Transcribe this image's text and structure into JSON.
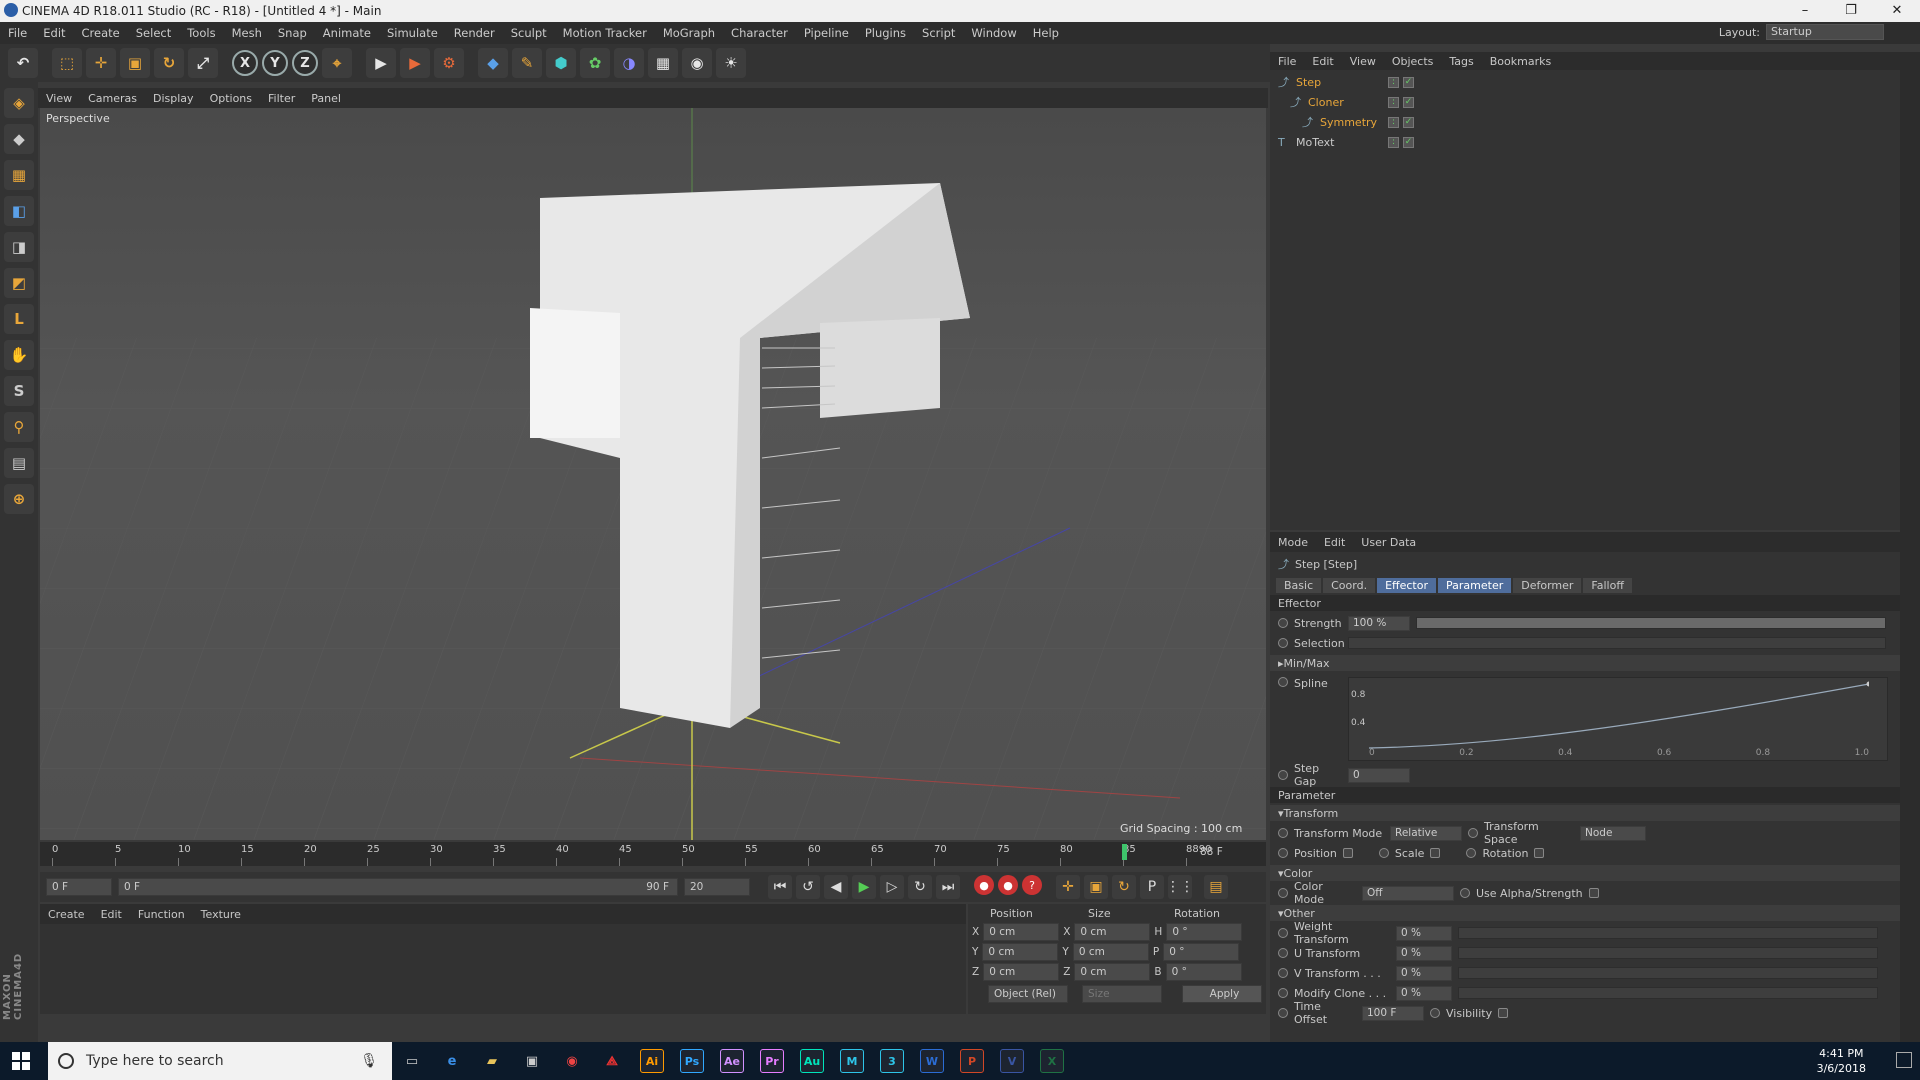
{
  "window": {
    "title": "CINEMA 4D R18.011 Studio (RC - R18) - [Untitled 4 *] - Main",
    "minimize": "–",
    "maximize": "❐",
    "close": "✕"
  },
  "menubar": [
    "File",
    "Edit",
    "Create",
    "Select",
    "Tools",
    "Mesh",
    "Snap",
    "Animate",
    "Simulate",
    "Render",
    "Sculpt",
    "Motion Tracker",
    "MoGraph",
    "Character",
    "Pipeline",
    "Plugins",
    "Script",
    "Window",
    "Help"
  ],
  "layout": {
    "label": "Layout:",
    "value": "Startup"
  },
  "toolbar": {
    "undo": "↶",
    "select": "⬚",
    "move": "✛",
    "scale": "▣",
    "rotate": "↻",
    "last": "⤢",
    "axis_x": "X",
    "axis_y": "Y",
    "axis_z": "Z",
    "coord_system": "⌖",
    "render_view": "▶",
    "render_pic": "▶",
    "render_settings": "⚙",
    "cube": "◆",
    "pen": "✎",
    "subdiv": "⬢",
    "cloner": "✿",
    "deformer": "◑",
    "floor": "▦",
    "camera": "◉",
    "light": "☀"
  },
  "left_tools": [
    "◈",
    "◆",
    "▦",
    "◧",
    "◨",
    "◩",
    "L",
    "✋",
    "S",
    "⚲",
    "▤",
    "⊕"
  ],
  "viewport": {
    "menu": [
      "View",
      "Cameras",
      "Display",
      "Options",
      "Filter",
      "Panel"
    ],
    "label": "Perspective",
    "grid_spacing": "Grid Spacing : 100 cm"
  },
  "timeline": {
    "ticks": [
      "0",
      "5",
      "10",
      "15",
      "20",
      "25",
      "30",
      "35",
      "40",
      "45",
      "50",
      "55",
      "60",
      "65",
      "70",
      "75",
      "80",
      "85",
      "8890"
    ],
    "current_frame": "88 F"
  },
  "transport": {
    "start": "0 F",
    "range_start": "0 F",
    "range_end": "90 F",
    "end": "20"
  },
  "material_manager": {
    "menu": [
      "Create",
      "Edit",
      "Function",
      "Texture"
    ]
  },
  "coordinates": {
    "headers": [
      "Position",
      "Size",
      "Rotation"
    ],
    "rows": [
      {
        "axis": "X",
        "pos": "0 cm",
        "saxis": "X",
        "size": "0 cm",
        "raxis": "H",
        "rot": "0 °"
      },
      {
        "axis": "Y",
        "pos": "0 cm",
        "saxis": "Y",
        "size": "0 cm",
        "raxis": "P",
        "rot": "0 °"
      },
      {
        "axis": "Z",
        "pos": "0 cm",
        "saxis": "Z",
        "size": "0 cm",
        "raxis": "B",
        "rot": "0 °"
      }
    ],
    "mode": "Object (Rel)",
    "size_mode": "Size",
    "apply": "Apply"
  },
  "object_manager": {
    "menu": [
      "File",
      "Edit",
      "View",
      "Objects",
      "Tags",
      "Bookmarks"
    ],
    "objects": [
      {
        "name": "Step",
        "indent": 0,
        "color": "#e8a63a"
      },
      {
        "name": "Cloner",
        "indent": 1,
        "color": "#e8a63a"
      },
      {
        "name": "Symmetry",
        "indent": 2,
        "color": "#e8a63a"
      },
      {
        "name": "MoText",
        "indent": 0,
        "color": "#cccccc"
      }
    ]
  },
  "attributes": {
    "menu": [
      "Mode",
      "Edit",
      "User Data"
    ],
    "object_title": "Step [Step]",
    "tabs": [
      "Basic",
      "Coord.",
      "Effector",
      "Parameter",
      "Deformer",
      "Falloff"
    ],
    "active_tabs": [
      "Effector",
      "Parameter"
    ],
    "effector_section": "Effector",
    "strength_label": "Strength",
    "strength_value": "100 %",
    "selection_label": "Selection",
    "minmax": "Min/Max",
    "spline_label": "Spline",
    "spline_y": [
      "0.8",
      "0.4"
    ],
    "spline_x": [
      "0",
      "0.2",
      "0.4",
      "0.6",
      "0.8",
      "1.0"
    ],
    "stepgap_label": "Step Gap",
    "stepgap_value": "0",
    "parameter_section": "Parameter",
    "transform_sub": "Transform",
    "transform_mode_label": "Transform Mode",
    "transform_mode": "Relative",
    "transform_space_label": "Transform Space",
    "transform_space": "Node",
    "position": "Position",
    "scale": "Scale",
    "rotation": "Rotation",
    "color_sub": "Color",
    "color_mode_label": "Color Mode",
    "color_mode": "Off",
    "use_alpha": "Use Alpha/Strength",
    "other_sub": "Other",
    "weight_label": "Weight Transform",
    "weight_value": "0 %",
    "u_label": "U Transform",
    "u_value": "0 %",
    "v_label": "V Transform . . .",
    "v_value": "0 %",
    "modify_label": "Modify Clone . . .",
    "modify_value": "0 %",
    "time_label": "Time Offset",
    "time_value": "100 F",
    "visibility": "Visibility"
  },
  "taskbar": {
    "search_placeholder": "Type here to search",
    "apps": [
      "Ai",
      "Ps",
      "Ae",
      "Pr",
      "Au",
      "M",
      "3",
      "W",
      "P",
      "V",
      "X"
    ],
    "time": "4:41 PM",
    "date": "3/6/2018"
  }
}
